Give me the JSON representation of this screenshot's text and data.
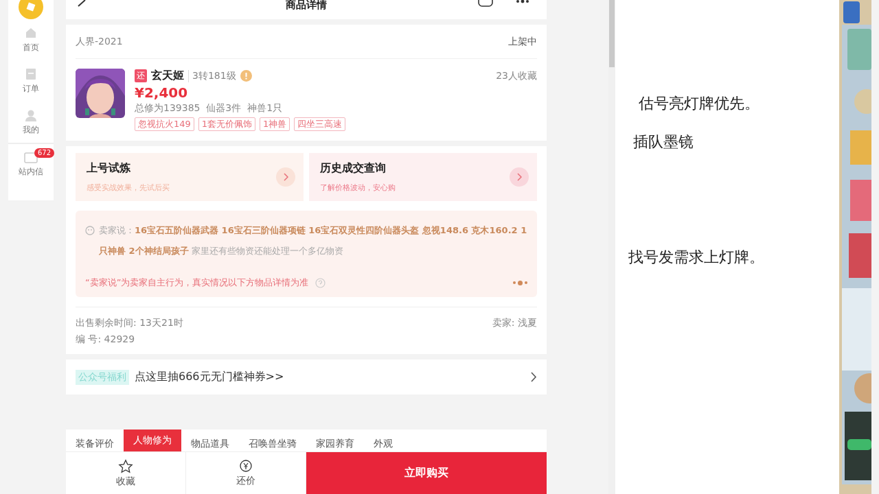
{
  "sidebar": {
    "items": [
      {
        "label": "首页"
      },
      {
        "label": "订单"
      },
      {
        "label": "我的"
      },
      {
        "label": "站内信",
        "badge": "672"
      }
    ]
  },
  "header": {
    "title": "商品详情"
  },
  "listing": {
    "server": "人界-2021",
    "status": "上架中",
    "tag": "还",
    "name": "玄天姬",
    "level": "3转181级",
    "favorites": "23人收藏",
    "price": "¥2,400",
    "summary": "总修为139385  仙器3件  神兽1只",
    "labels": [
      "忽视抗火149",
      "1套无价佩饰",
      "1神兽",
      "四坐三高速"
    ]
  },
  "shortcuts": [
    {
      "title": "上号试炼",
      "subtitle": "感受实战效果，先试后买"
    },
    {
      "title": "历史成交查询",
      "subtitle": "了解价格波动，安心购"
    }
  ],
  "seller_note": {
    "text": "卖家说：**16宝石五阶仙器武器 16宝石三阶仙器项链 16宝石双灵性四阶仙器头盔 忽视148.6 克木160.2 1只神兽 2个神结局孩子** 家里还有些物资还能处理一个多亿物资",
    "disclaimer": "“卖家说”为卖家自主行为，真实情况以下方物品详情为准",
    "pages": [
      {
        "selected": false
      },
      {
        "selected": true
      },
      {
        "selected": false
      }
    ]
  },
  "sale_info": {
    "remaining": "出售剩余时间: 13天21时",
    "seller": "卖家: 浅夏",
    "serial": "编 号: 42929"
  },
  "promo": {
    "badge": "公众号福利",
    "text": "点这里抽666元无门槛神券>>"
  },
  "tabs": [
    {
      "label": "装备评价",
      "selected": false
    },
    {
      "label": "人物修为",
      "selected": true
    },
    {
      "label": "物品道具",
      "selected": false
    },
    {
      "label": "召唤兽坐骑",
      "selected": false
    },
    {
      "label": "家园养育",
      "selected": false
    },
    {
      "label": "外观",
      "selected": false
    }
  ],
  "bottom_bar": {
    "favorite": "收藏",
    "bargain": "还价",
    "buy": "立即购买"
  },
  "notes": [
    "估号亮灯牌优先。",
    "插队墨镜",
    "找号发需求上灯牌。"
  ],
  "game_strip": {
    "kind": "picture"
  }
}
